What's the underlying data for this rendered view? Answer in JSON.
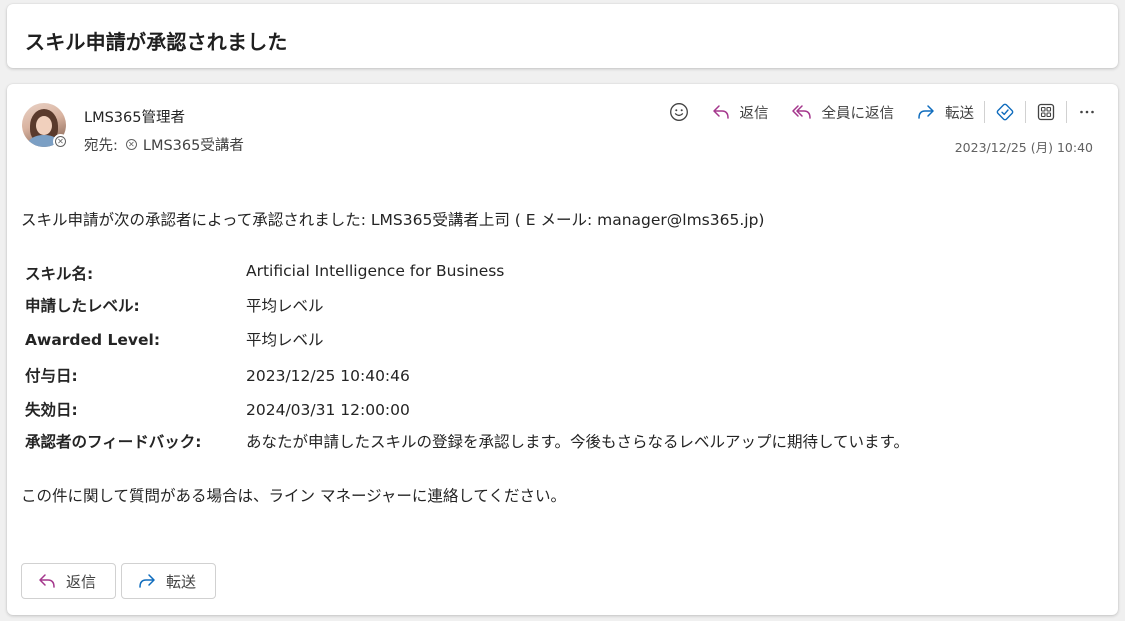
{
  "subject": "スキル申請が承認されました",
  "sender": {
    "name": "LMS365管理者",
    "to_prefix": "宛先:",
    "to_name": "LMS365受講者"
  },
  "toolbar": {
    "reply_label": "返信",
    "reply_all_label": "全員に返信",
    "forward_label": "転送",
    "icons": [
      "emoji-icon",
      "reply-icon",
      "reply-all-icon",
      "forward-icon",
      "teams-share-icon",
      "apps-icon",
      "more-icon"
    ]
  },
  "date": "2023/12/25 (月) 10:40",
  "body": {
    "intro": "スキル申請が次の承認者によって承認されました: LMS365受講者上司 ( E メール: manager@lms365.jp)",
    "details": [
      {
        "key": "スキル名:",
        "value": "Artificial Intelligence for Business"
      },
      {
        "key": "申請したレベル:",
        "value": "平均レベル"
      },
      {
        "key": "Awarded Level:",
        "value": "平均レベル"
      },
      {
        "key": "付与日:",
        "value": "2023/12/25 10:40:46"
      },
      {
        "key": "失効日:",
        "value": "2024/03/31 12:00:00"
      },
      {
        "key": "承認者のフィードバック:",
        "value": "あなたが申請したスキルの登録を承認します。今後もさらなるレベルアップに期待しています。"
      }
    ],
    "closing": "この件に関して質問がある場合は、ライン マネージャーに連絡してください。"
  },
  "footer": {
    "reply_label": "返信",
    "forward_label": "転送"
  },
  "colors": {
    "reply_accent": "#a4368c",
    "forward_accent": "#0f6cbd",
    "teams_accent": "#0f6cbd"
  }
}
